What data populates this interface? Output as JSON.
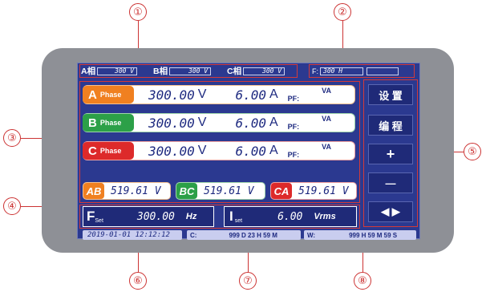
{
  "callouts": [
    "①",
    "②",
    "③",
    "④",
    "⑤",
    "⑥",
    "⑦",
    "⑧"
  ],
  "top": {
    "a_label": "A相",
    "a_val": "300  V",
    "b_label": "B相",
    "b_val": "300  V",
    "c_label": "C相",
    "c_val": "300  V",
    "f_label": "F:",
    "f_val": "300 H"
  },
  "phases": [
    {
      "tag": "A",
      "sub": "Phase",
      "voltage": "300.00",
      "v_unit": "V",
      "current": "6.00",
      "a_unit": "A",
      "pf": "PF:",
      "va": "VA",
      "color": "#f08020"
    },
    {
      "tag": "B",
      "sub": "Phase",
      "voltage": "300.00",
      "v_unit": "V",
      "current": "6.00",
      "a_unit": "A",
      "pf": "PF:",
      "va": "VA",
      "color": "#2ca048"
    },
    {
      "tag": "C",
      "sub": "Phase",
      "voltage": "300.00",
      "v_unit": "V",
      "current": "6.00",
      "a_unit": "A",
      "pf": "PF:",
      "va": "VA",
      "color": "#dd2a2a"
    }
  ],
  "line": [
    {
      "tag": "AB",
      "value": "519.61  V",
      "color": "#f08020"
    },
    {
      "tag": "BC",
      "value": "519.61 V",
      "color": "#2ca048"
    },
    {
      "tag": "CA",
      "value": "519.61 V",
      "color": "#dd2a2a"
    }
  ],
  "fset": {
    "label": "F",
    "sub": "Set",
    "value": "300.00",
    "unit": "Hz"
  },
  "iset": {
    "label": "I",
    "sub": "set",
    "value": "6.00",
    "unit": "Vrms"
  },
  "side": {
    "setup": "设 置",
    "program": "编 程",
    "plus": "+",
    "minus": "—",
    "arrows": "◀  ▶"
  },
  "status": {
    "datetime": "2019-01-01  12:12:12",
    "c_label": "C:",
    "c_val": "999 D 23 H 59 M",
    "w_label": "W:",
    "w_val": "999 H 59 M 59 S"
  }
}
